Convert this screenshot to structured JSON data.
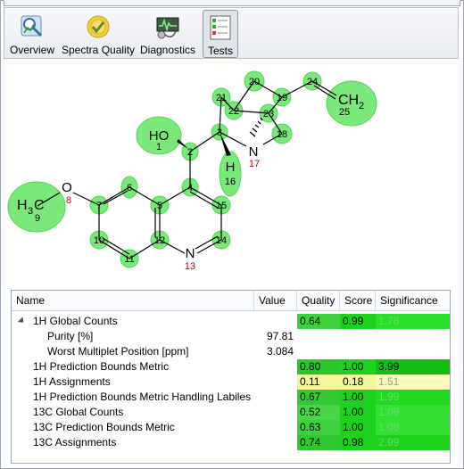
{
  "toolbar": {
    "buttons": [
      {
        "label": "Overview",
        "icon": "overview-icon"
      },
      {
        "label": "Spectra Quality",
        "icon": "spectra-quality-icon"
      },
      {
        "label": "Diagnostics",
        "icon": "diagnostics-icon"
      },
      {
        "label": "Tests",
        "icon": "tests-icon",
        "active": true
      }
    ]
  },
  "molecule": {
    "atoms": {
      "ho": "HO",
      "ho_num": "1",
      "c2": "2",
      "c3": "3",
      "c4": "4",
      "c5": "5",
      "c6": "6",
      "c7": "7",
      "o8": "O",
      "o8_num": "8",
      "h3c": "H",
      "h3c_c": "C",
      "h3c_sub": "3",
      "h3c_num": "9",
      "c10": "10",
      "c11": "11",
      "c12": "12",
      "n13": "N",
      "n13_num": "13",
      "c14": "14",
      "c15": "15",
      "h16": "H",
      "h16_num": "16",
      "n17": "N",
      "n17_num": "17",
      "c18": "18",
      "c19": "19",
      "c20": "20",
      "c21": "21",
      "c22": "22",
      "c23": "23",
      "c24": "24",
      "ch2": "CH",
      "ch2_sub": "2",
      "ch2_num": "25"
    },
    "highlight_color": "#7ae87a"
  },
  "table": {
    "columns": {
      "name": "Name",
      "value": "Value",
      "quality": "Quality",
      "score": "Score",
      "significance": "Significance"
    },
    "rows": [
      {
        "name": "1H Global Counts",
        "level": 0,
        "expander": true,
        "value": "",
        "quality": "0.64",
        "score": "0.99",
        "significance": "1.78",
        "qcolor": "#3fcf3f",
        "scolor": "#1fd11f",
        "gcolor": "#2cde2c",
        "gtext": "#6edb6e"
      },
      {
        "name": "Purity [%]",
        "level": 1,
        "value": "97.81",
        "quality": "",
        "score": "",
        "significance": ""
      },
      {
        "name": "Worst Multiplet Position [ppm]",
        "level": 1,
        "value": "3.084",
        "quality": "",
        "score": "",
        "significance": ""
      },
      {
        "name": "1H Prediction Bounds Metric",
        "level": 0,
        "value": "",
        "quality": "0.80",
        "score": "1.00",
        "significance": "3.99",
        "qcolor": "#2bc42b",
        "scolor": "#1fd11f",
        "gcolor": "#14be14",
        "gtext": "#000000"
      },
      {
        "name": "1H Assignments",
        "level": 0,
        "value": "",
        "quality": "0.11",
        "score": "0.18",
        "significance": "1.51",
        "qcolor": "#f5f59a",
        "scolor": "#f5f59a",
        "gcolor": "#fbfbbe",
        "gtext": "#a0a070"
      },
      {
        "name": "1H Prediction Bounds Metric Handling Labiles",
        "level": 0,
        "value": "",
        "quality": "0.67",
        "score": "1.00",
        "significance": "1.99",
        "qcolor": "#35c835",
        "scolor": "#1fd11f",
        "gcolor": "#22d822",
        "gtext": "#6edb6e"
      },
      {
        "name": "13C Global Counts",
        "level": 0,
        "value": "",
        "quality": "0.52",
        "score": "1.00",
        "significance": "1.09",
        "qcolor": "#4ad44a",
        "scolor": "#1fd11f",
        "gcolor": "#33e033",
        "gtext": "#6edb6e"
      },
      {
        "name": "13C Prediction Bounds Metric",
        "level": 0,
        "value": "",
        "quality": "0.63",
        "score": "1.00",
        "significance": "1.08",
        "qcolor": "#3fcf3f",
        "scolor": "#1fd11f",
        "gcolor": "#33e033",
        "gtext": "#6edb6e"
      },
      {
        "name": "13C Assignments",
        "level": 0,
        "value": "",
        "quality": "0.74",
        "score": "0.98",
        "significance": "2.99",
        "qcolor": "#30c630",
        "scolor": "#1fd11f",
        "gcolor": "#1cd01c",
        "gtext": "#6edb6e"
      }
    ]
  }
}
